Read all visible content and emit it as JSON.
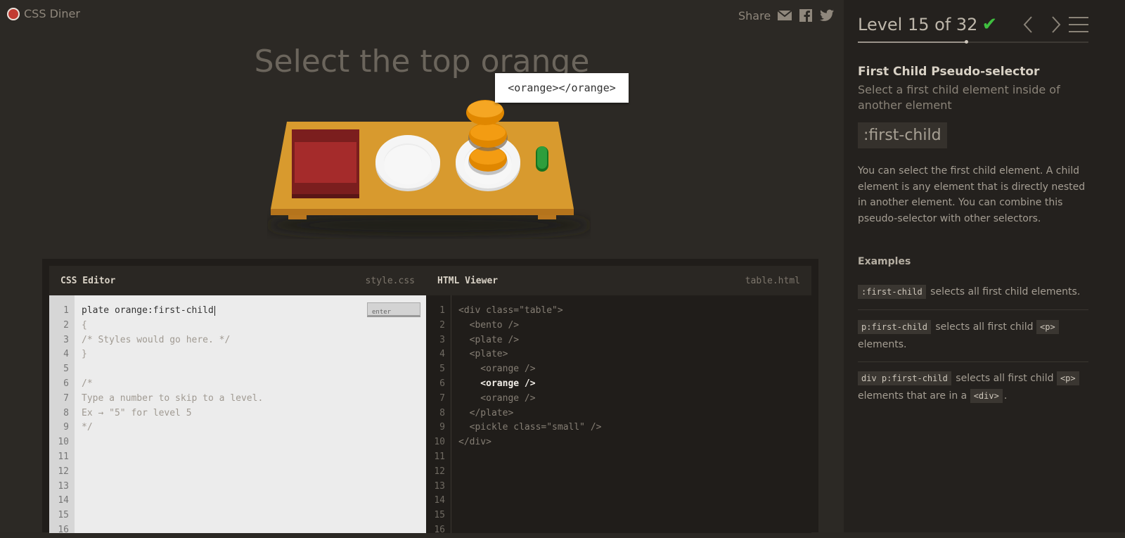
{
  "app": {
    "name": "CSS Diner"
  },
  "header": {
    "share_label": "Share",
    "share_icons": [
      "email-icon",
      "facebook-icon",
      "twitter-icon"
    ]
  },
  "game": {
    "instruction": "Select the top orange",
    "tooltip": "<orange></orange>"
  },
  "css_editor": {
    "title": "CSS Editor",
    "file": "style.css",
    "input_value": "plate orange:first-child",
    "enter_label": "enter",
    "lines": [
      "{",
      "/* Styles would go here. */",
      "}",
      "",
      "/*",
      "Type a number to skip to a level.",
      "Ex → \"5\" for level 5",
      "*/"
    ],
    "line_numbers": [
      "1",
      "2",
      "3",
      "4",
      "5",
      "6",
      "7",
      "8",
      "9",
      "10",
      "11",
      "12",
      "13",
      "14",
      "15",
      "16"
    ]
  },
  "html_viewer": {
    "title": "HTML Viewer",
    "file": "table.html",
    "lines": [
      "<div class=\"table\">",
      "  <bento />",
      "  <plate />",
      "  <plate>",
      "    <orange />",
      "    <orange />",
      "    <orange />",
      "  </plate>",
      "  <pickle class=\"small\" />",
      "</div>"
    ],
    "highlighted_line": 6,
    "line_numbers": [
      "1",
      "2",
      "3",
      "4",
      "5",
      "6",
      "7",
      "8",
      "9",
      "10",
      "11",
      "12",
      "13",
      "14",
      "15",
      "16"
    ]
  },
  "sidebar": {
    "level_label": "Level 15 of 32",
    "level_complete": true,
    "progress_fraction": 0.47,
    "lesson_title": "First Child Pseudo-selector",
    "lesson_subtitle": "Select a first child element inside of another element",
    "selector": ":first-child",
    "description": "You can select the first child element. A child element is any element that is directly nested in another element. You can combine this pseudo-selector with other selectors.",
    "examples_heading": "Examples",
    "examples": [
      {
        "code": ":first-child",
        "text": "selects all first child elements."
      },
      {
        "code": "p:first-child",
        "text": "selects all first child",
        "code2": "<p>",
        "text2": "elements."
      },
      {
        "code": "div p:first-child",
        "text": "selects all first child",
        "code2": "<p>",
        "text2": "elements that are in a",
        "code3": "<div>",
        "text3": "."
      }
    ]
  },
  "colors": {
    "background": "#2c2925",
    "sidebar": "#24211e",
    "orange": "#f39c12",
    "table": "#d08f2a",
    "bento": "#a02b2b",
    "pickle": "#2e9e3c",
    "check": "#3fbf3f"
  }
}
